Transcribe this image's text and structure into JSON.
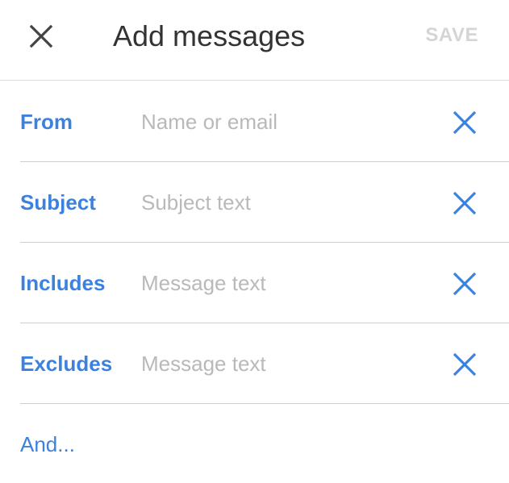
{
  "header": {
    "close_icon": "close-icon",
    "title": "Add messages",
    "save_label": "SAVE"
  },
  "colors": {
    "accent": "#3b82e0",
    "save_disabled": "#d5d5d5",
    "placeholder": "#b9b9b9",
    "divider": "#cfcfcf"
  },
  "fields": [
    {
      "label": "From",
      "placeholder": "Name or email",
      "value": "",
      "clear_icon": "clear-icon"
    },
    {
      "label": "Subject",
      "placeholder": "Subject text",
      "value": "",
      "clear_icon": "clear-icon"
    },
    {
      "label": "Includes",
      "placeholder": "Message text",
      "value": "",
      "clear_icon": "clear-icon"
    },
    {
      "label": "Excludes",
      "placeholder": "Message text",
      "value": "",
      "clear_icon": "clear-icon"
    }
  ],
  "footer": {
    "and_label": "And..."
  }
}
